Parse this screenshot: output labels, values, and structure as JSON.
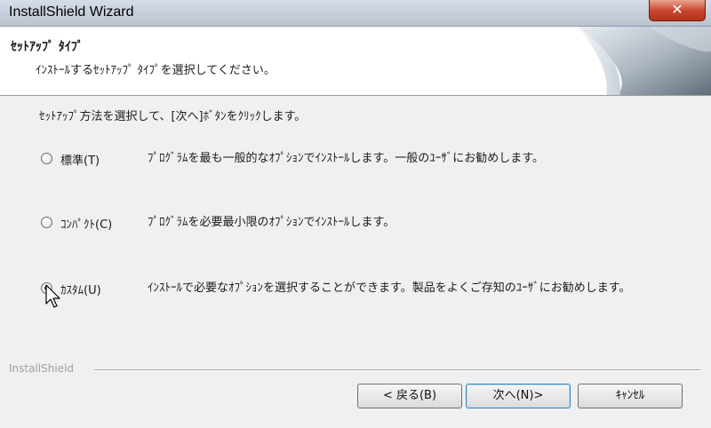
{
  "window": {
    "title": "InstallShield Wizard",
    "close_glyph": "✕"
  },
  "header": {
    "title": "ｾｯﾄｱｯﾌﾟ ﾀｲﾌﾟ",
    "subtitle": "ｲﾝｽﾄｰﾙするｾｯﾄｱｯﾌﾟ ﾀｲﾌﾟを選択してください。"
  },
  "body": {
    "instruction": "ｾｯﾄｱｯﾌﾟ方法を選択して、[次へ]ﾎﾞﾀﾝをｸﾘｯｸします。",
    "options": [
      {
        "label": "標準(T)",
        "description": "ﾌﾟﾛｸﾞﾗﾑを最も一般的なｵﾌﾟｼｮﾝでｲﾝｽﾄｰﾙします。一般のﾕｰｻﾞにお勧めします。",
        "selected": false
      },
      {
        "label": "ｺﾝﾊﾟｸﾄ(C)",
        "description": "ﾌﾟﾛｸﾞﾗﾑを必要最小限のｵﾌﾟｼｮﾝでｲﾝｽﾄｰﾙします。",
        "selected": false
      },
      {
        "label": "ｶｽﾀﾑ(U)",
        "description": "ｲﾝｽﾄｰﾙで必要なｵﾌﾟｼｮﾝを選択することができます。製品をよくご存知のﾕｰｻﾞにお勧めします。",
        "selected": true
      }
    ]
  },
  "footer": {
    "brand": "InstallShield",
    "back_label": "< 戻る(B)",
    "next_label": "次へ(N)>",
    "cancel_label": "ｷｬﾝｾﾙ"
  },
  "icons": {
    "close": "close-icon",
    "page_curl": "page-curl-icon",
    "cursor": "mouse-cursor-icon"
  }
}
